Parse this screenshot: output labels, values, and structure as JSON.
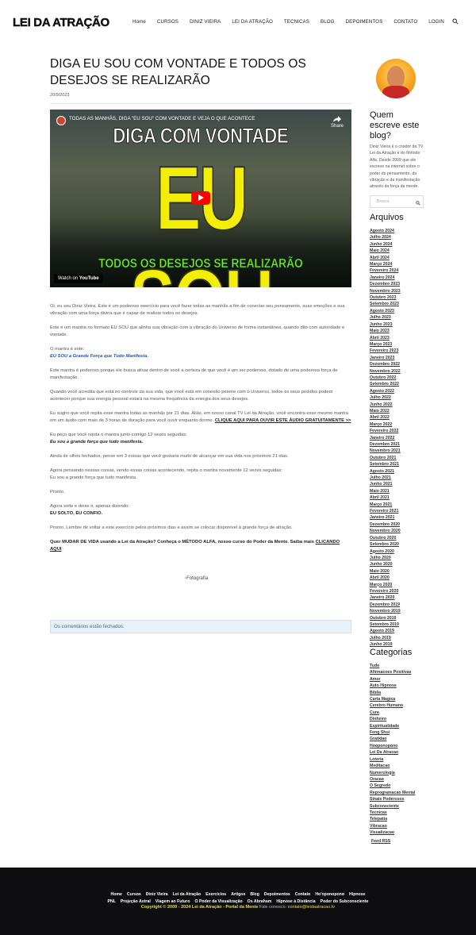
{
  "header": {
    "logo": "LEI DA ATRAÇÃO",
    "nav": [
      "Home",
      "CURSOS",
      "DINIZ VIEIRA",
      "LEI DA ATRAÇÃO",
      "TECNICAS",
      "BLOG",
      "DEPOIMENTOS",
      "CONTATO",
      "LOGIN"
    ]
  },
  "post": {
    "title": "DIGA EU SOU COM VONTADE E TODOS OS DESEJOS SE REALIZARÃO",
    "date": "20/9/2023",
    "video": {
      "channel_title": "TODAS AS MANHÃS, DIGA \"EU SOU\" COM VONTADE E VEJA O QUE ACONTECE",
      "share": "Share",
      "line1": "DIGA COM VONTADE",
      "line2": "EU SOU",
      "line3": "TODOS OS DESEJOS SE REALIZARÃO",
      "watch_on": "Watch on",
      "youtube": "YouTube"
    },
    "p1": "Oi, eu sou Diniz Vieira. Este é um poderoso exercício para você fazer todas as manhãs a fim de conectar seu pensamento, suas emoções e sua vibração com uma força divina que é capaz de realizar todos os desejos.",
    "p2": "Este é um mantra no formato EU SOU que alinha sua vibração com a vibração do Universo de forma instantânea, quando dito com autoridade e vontade.",
    "p3_label": "O mantra é este:",
    "p3_mantra": "EU SOU a Grande Força que Tudo Manifesta.",
    "p4": "Este mantra é poderoso porque ele busca ativar dentro de você a certeza de que você é um ser poderoso, dotado de uma poderosa força de manifestação.",
    "p5": "Quando você acredita que está no controle da sua vida, que você está em conexão perene com o Universo, todos os seus pedidos podem acontecer porque sua energia pessoal estará na mesma frequência da energia dos seus desejos.",
    "p6": "Eu sugiro que você repita esse mantra todas as manhãs por 21 dias. Aliás, em nosso canal TV Lei da Atração, você encontra esse mesmo mantra em um áudio com mais de 3 horas de duração para você ouvir enquanto dorme.",
    "p6_link": "CLIQUE AQUI PARA OUVIR ESTE ÁUDIO GRATUITAMENTE >>",
    "p7": "Eu peço que você repita o mantra junto comigo 12 vezes seguidas:",
    "p7_mantra": "Eu sou a grande força que tudo manifesta.",
    "p8": "Ainda de olhos fechados, pense em 3 coisas que você gostaria muito de alcançar em sua vida nos próximos 21 dias.",
    "p9": "Agora pensando nessas coisas, vendo essas coisas acontecendo, repita o mantra novamente 12 vezes seguidas:",
    "p9b": "Eu sou a grande força que tudo manifesta.",
    "p10": "Pronto.",
    "p11": "Agora solte e deixe ir, apenas dizendo:",
    "p11b": "EU SOLTO, EU CONFIO.",
    "p12": "Pronto. Lembre de voltar a este exercício pelos próximos dias e assim se colocar disponível à grande força de atração.",
    "cta": "Quer MUDAR DE VIDA usando a Lei da Atração? Conheça o MÉTODO ALFA, nosso curso do Poder da Mente. Saiba mais",
    "cta_link": "CLICANDO AQUI",
    "image_alt": "Fotografia",
    "comments_closed": "Os comentários estão fechados."
  },
  "sidebar": {
    "quem_title": "Quem escreve este blog?",
    "quem_desc": "Diniz Vieira é o criador da TV Lei da Atração e do Método Alfa. Desde 2009 que ele escreve na internet sobre o poder do pensamento, da vibração e da manifestação através da força da mente.",
    "search_placeholder": "Busca",
    "archives_title": "Arquivos",
    "archives": [
      "Agosto 2024",
      "Julho 2024",
      "Junho 2024",
      "Maio 2024",
      "Abril 2024",
      "Março 2024",
      "Fevereiro 2024",
      "Janeiro 2024",
      "Dezembro 2023",
      "Novembro 2023",
      "Outubro 2023",
      "Setembro 2023",
      "Agosto 2023",
      "Julho 2023",
      "Junho 2023",
      "Maio 2023",
      "Abril 2023",
      "Março 2023",
      "Fevereiro 2023",
      "Janeiro 2023",
      "Dezembro 2022",
      "Novembro 2022",
      "Outubro 2022",
      "Setembro 2022",
      "Agosto 2022",
      "Julho 2022",
      "Junho 2022",
      "Maio 2022",
      "Abril 2022",
      "Março 2022",
      "Fevereiro 2022",
      "Janeiro 2022",
      "Dezembro 2021",
      "Novembro 2021",
      "Outubro 2021",
      "Setembro 2021",
      "Agosto 2021",
      "Julho 2021",
      "Junho 2021",
      "Maio 2021",
      "Abril 2021",
      "Março 2021",
      "Fevereiro 2021",
      "Janeiro 2021",
      "Dezembro 2020",
      "Novembro 2020",
      "Outubro 2020",
      "Setembro 2020",
      "Agosto 2020",
      "Julho 2020",
      "Junho 2020",
      "Maio 2020",
      "Abril 2020",
      "Março 2020",
      "Fevereiro 2020",
      "Janeiro 2020",
      "Dezembro 2019",
      "Novembro 2019",
      "Outubro 2019",
      "Setembro 2019",
      "Agosto 2019",
      "Julho 2019",
      "Junho 2019"
    ],
    "categories_title": "Categorias",
    "categories": [
      "Tudo",
      "Afirmacoes Positivas",
      "Amor",
      "Auto Hipnose",
      "Biblia",
      "Carta Magica",
      "Cerebro Humano",
      "Cura",
      "Dinheiro",
      "Espiritualidade",
      "Feng Shui",
      "Gratidao",
      "Hooponopono",
      "Lei Da Atracao",
      "Loteria",
      "Meditacao",
      "Numerologia",
      "Oracao",
      "O Segredo",
      "Reprogramacao Mental",
      "Sinais Poderosos",
      "Subconsciente",
      "Tecnicas",
      "Telepatia",
      "Vibracao",
      "Visualizacao"
    ],
    "feed": "Feed RSS"
  },
  "footer": {
    "links1": [
      "Home",
      "Cursos",
      "Diniz Vieira",
      "Lei da Atração",
      "Exercícios",
      "Artigos",
      "Blog",
      "Depoimentos",
      "Contato",
      "Ho'oponopono",
      "Hipnose"
    ],
    "links2": [
      "PNL",
      "Projeção Astral",
      "Viagem ao Futuro",
      "O Poder da Visualização",
      "Os Abraham",
      "Hipnose à Distância",
      "Poder do Subconsciente"
    ],
    "copyright": "Copyright © 2009 - 2024 Lei da Atração - Portal da Mente",
    "contact_label": "Fale conosco:",
    "email": "contato@leidaatracao.tv"
  }
}
